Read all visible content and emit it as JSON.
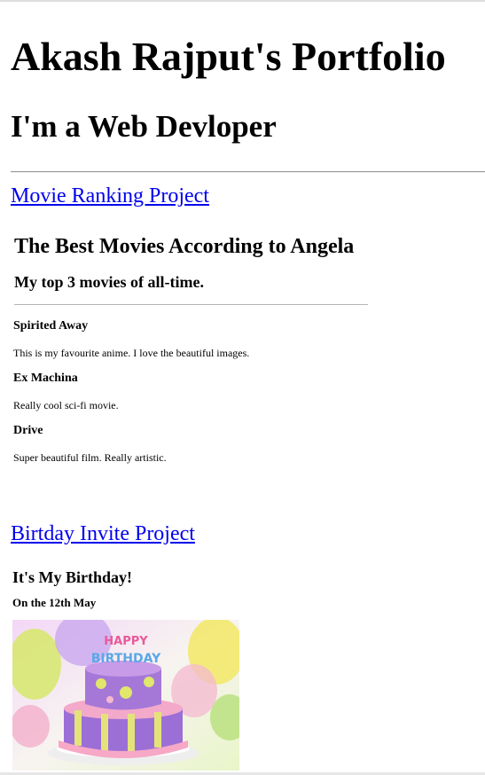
{
  "header": {
    "title": "Akash Rajput's Portfolio",
    "subtitle": "I'm a Web Devloper"
  },
  "projects": [
    {
      "link": "Movie Ranking Project"
    },
    {
      "link": "Birtday Invite Project"
    }
  ],
  "movies_page": {
    "title": "The Best Movies According to Angela",
    "subtitle": "My top 3 movies of all-time.",
    "movies": [
      {
        "title": "Spirited Away",
        "desc": "This is my favourite anime. I love the beautiful images."
      },
      {
        "title": "Ex Machina",
        "desc": "Really cool sci-fi movie."
      },
      {
        "title": "Drive",
        "desc": "Super beautiful film. Really artistic."
      }
    ]
  },
  "birthday_page": {
    "title": "It's My Birthday!",
    "date": "On the 12th May",
    "cake_image": "birthday-cake-icon",
    "cake_text": "HAPPY BIRTHDAY"
  },
  "colors": {
    "link": "#0000ee",
    "text": "#000000"
  }
}
